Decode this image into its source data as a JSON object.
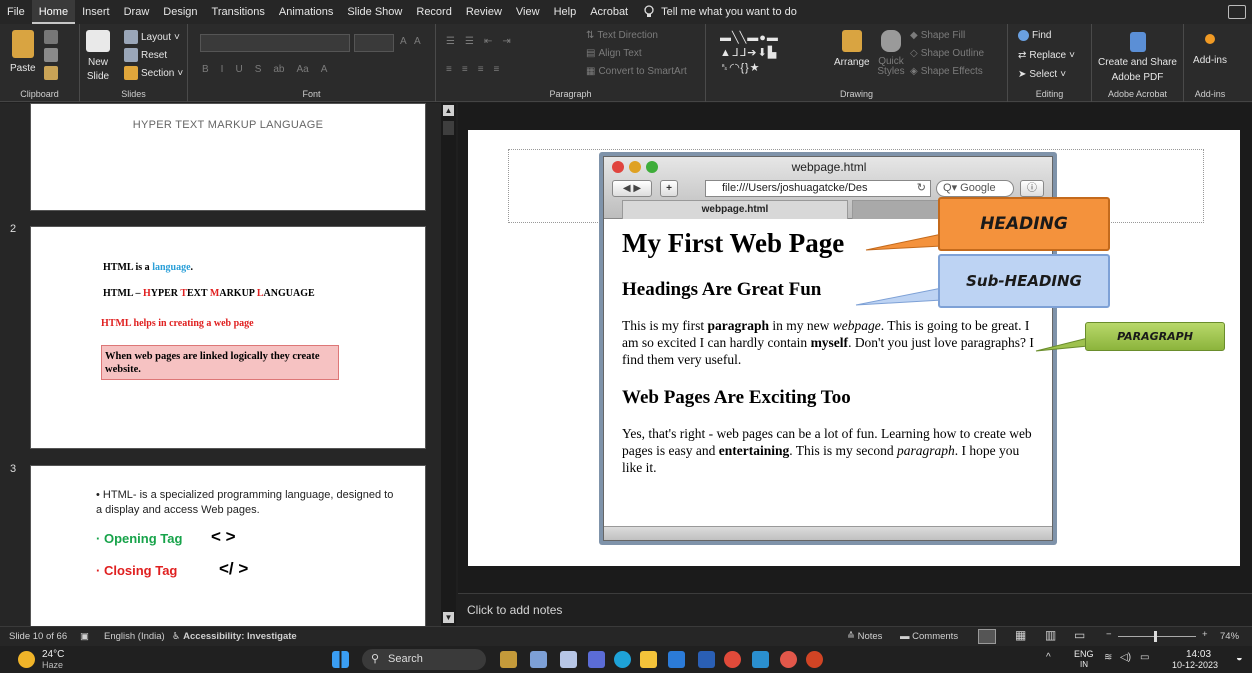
{
  "menu": {
    "items": [
      "File",
      "Home",
      "Insert",
      "Draw",
      "Design",
      "Transitions",
      "Animations",
      "Slide Show",
      "Record",
      "Review",
      "View",
      "Help",
      "Acrobat"
    ],
    "active": "Home",
    "tell_me": "Tell me what you want to do"
  },
  "ribbon": {
    "clipboard": {
      "paste": "Paste",
      "label": "Clipboard"
    },
    "slides": {
      "new": "New",
      "slide": "Slide",
      "layout": "Layout",
      "reset": "Reset",
      "section": "Section",
      "label": "Slides"
    },
    "font": {
      "label": "Font"
    },
    "paragraph": {
      "text_direction": "Text Direction",
      "align_text": "Align Text",
      "smartart": "Convert to SmartArt",
      "label": "Paragraph"
    },
    "drawing": {
      "arrange": "Arrange",
      "quick_styles": "Quick Styles",
      "shape_fill": "Shape Fill",
      "shape_outline": "Shape Outline",
      "shape_effects": "Shape Effects",
      "label": "Drawing"
    },
    "editing": {
      "find": "Find",
      "replace": "Replace",
      "select": "Select",
      "label": "Editing"
    },
    "acrobat": {
      "create": "Create and Share",
      "create2": "Adobe PDF",
      "label": "Adobe Acrobat"
    },
    "addins": {
      "button": "Add-ins",
      "label": "Add-ins"
    }
  },
  "thumbs": {
    "slide1": {
      "title": "HYPER TEXT MARKUP LANGUAGE"
    },
    "slide2": {
      "num": "2",
      "line1a": "HTML is a ",
      "line1b": "language",
      "line1c": ".",
      "line2a": "HTML – ",
      "h": "H",
      "yper": "YPER ",
      "t": "T",
      "ext": "EXT ",
      "m": "M",
      "arkup": "ARKUP ",
      "l": "L",
      "anguage": "ANGUAGE",
      "line3": "HTML helps in creating a web page",
      "box": "When web pages are linked logically they create website."
    },
    "slide3": {
      "num": "3",
      "bullet": "HTML- is a specialized programming language, designed  to a display and access Web pages.",
      "opening": "Opening Tag",
      "opening_sym": "<   >",
      "closing": "Closing Tag",
      "closing_sym": "</   >"
    }
  },
  "browser": {
    "title": "webpage.html",
    "url": "file:///Users/joshuagatcke/Des",
    "search": "Google",
    "tab": "webpage.html",
    "h1": "My First Web Page",
    "h2a": "Headings Are Great Fun",
    "p1": {
      "a": "This is my first ",
      "b": "paragraph",
      "c": " in my new ",
      "d": "webpage",
      "e": ". This is going to be great. I am so excited I can hardly contain ",
      "f": "myself",
      "g": ". Don't you just love paragraphs? I find them very useful."
    },
    "h2b": "Web Pages Are Exciting Too",
    "p2": {
      "a": "Yes, that's right - web pages can be a lot of fun. Learning how to create web pages is easy and ",
      "b": "entertaining",
      "c": ". This is my second ",
      "d": "paragraph",
      "e": ". I hope you like it."
    }
  },
  "callouts": {
    "heading": "HEADING",
    "subheading": "Sub-HEADING",
    "paragraph": "PARAGRAPH"
  },
  "notes": "Click to add notes",
  "status": {
    "slide": "Slide 10 of 66",
    "language": "English (India)",
    "accessibility": "Accessibility: Investigate",
    "notes": "Notes",
    "comments": "Comments",
    "zoom": "74%"
  },
  "taskbar": {
    "temp": "24°C",
    "weather": "Haze",
    "search": "Search",
    "lang1": "ENG",
    "lang2": "IN",
    "time": "14:03",
    "date": "10-12-2023"
  }
}
